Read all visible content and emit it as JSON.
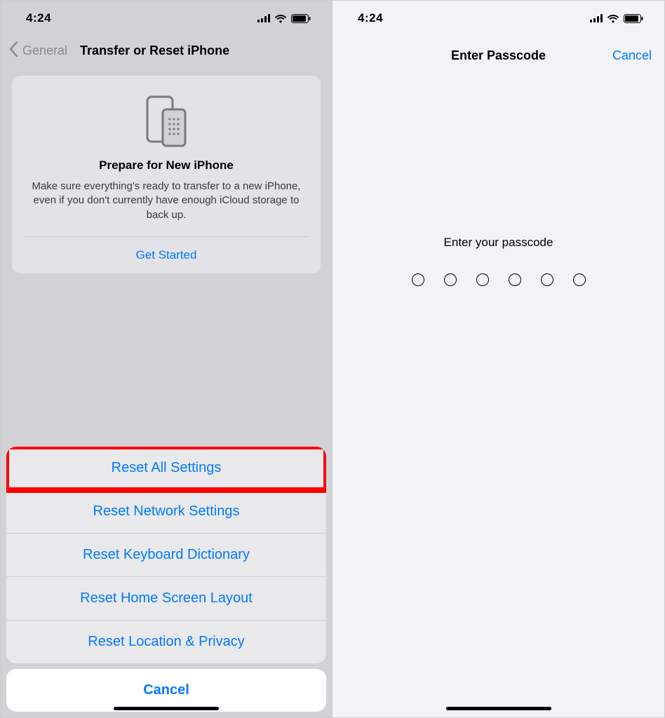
{
  "status": {
    "time": "4:24"
  },
  "left": {
    "back_label": "General",
    "title": "Transfer or Reset iPhone",
    "card": {
      "title": "Prepare for New iPhone",
      "body": "Make sure everything's ready to transfer to a new iPhone, even if you don't currently have enough iCloud storage to back up.",
      "link": "Get Started"
    },
    "sheet": {
      "items": [
        "Reset All Settings",
        "Reset Network Settings",
        "Reset Keyboard Dictionary",
        "Reset Home Screen Layout",
        "Reset Location & Privacy"
      ],
      "cancel": "Cancel"
    }
  },
  "right": {
    "title": "Enter Passcode",
    "cancel": "Cancel",
    "prompt": "Enter your passcode"
  }
}
